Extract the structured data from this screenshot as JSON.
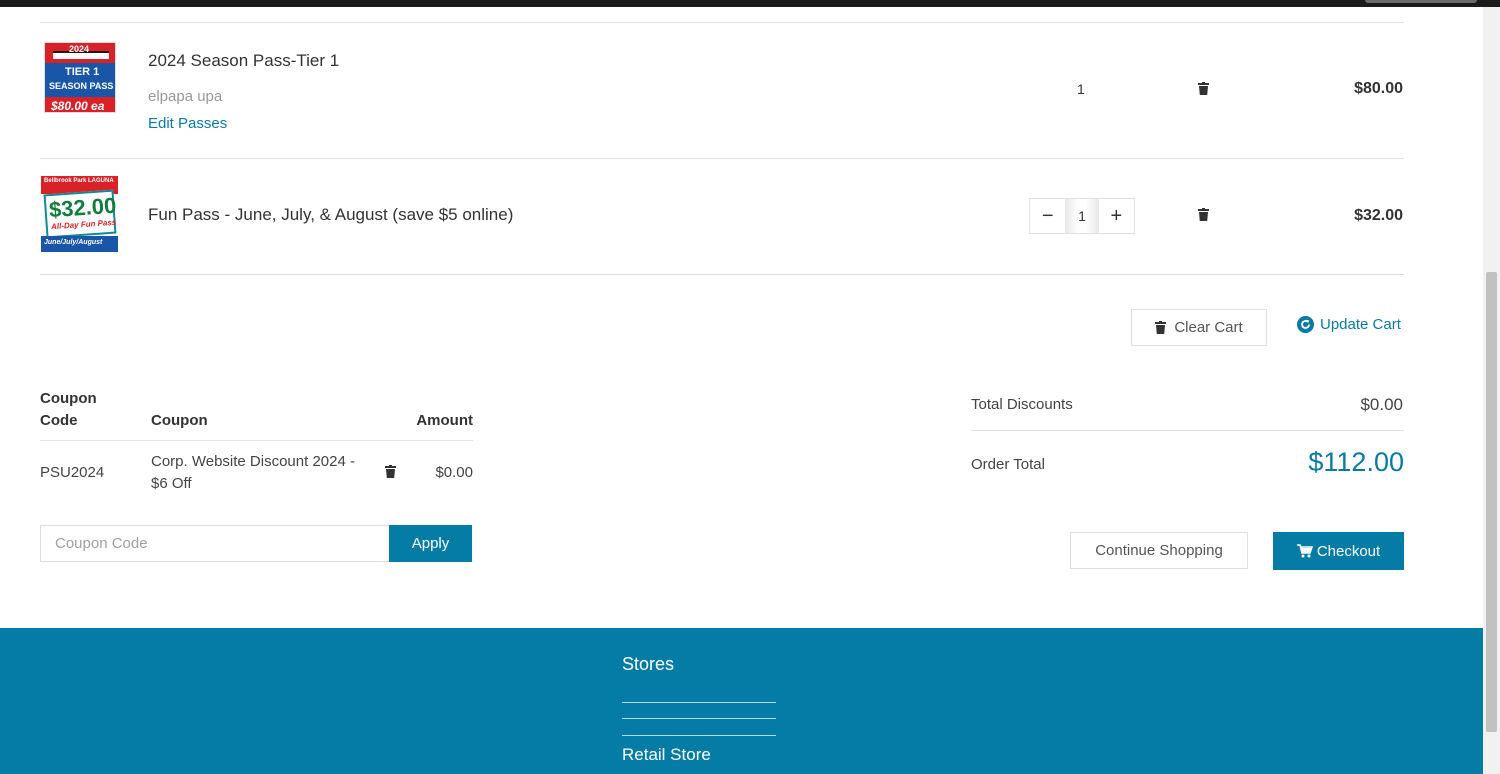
{
  "cart": {
    "items": [
      {
        "name": "2024 Season Pass-Tier 1",
        "subtitle": "elpapa upa",
        "edit_label": "Edit Passes",
        "quantity": "1",
        "price": "$80.00",
        "thumb": {
          "year": "2024",
          "tier": "TIER 1",
          "label": "SEASON PASS",
          "price": "$80.00 ea"
        }
      },
      {
        "name": "Fun Pass - June, July, & August (save $5 online)",
        "quantity": "1",
        "price": "$32.00",
        "thumb": {
          "top": "Bellbrook Park LAGUNA",
          "price": "$32.00",
          "label": "All-Day Fun Pass",
          "months": "June/July/August"
        }
      }
    ],
    "stepper": {
      "minus": "−",
      "plus": "+"
    },
    "clear_label": "Clear Cart",
    "update_label": "Update Cart"
  },
  "coupons": {
    "headers": {
      "code_line1": "Coupon",
      "code_line2": "Code",
      "coupon": "Coupon",
      "amount": "Amount"
    },
    "rows": [
      {
        "code": "PSU2024",
        "coupon_line1": "Corp. Website Discount 2024 -",
        "coupon_line2": "$6 Off",
        "amount": "$0.00"
      }
    ],
    "input_placeholder": "Coupon Code",
    "apply_label": "Apply"
  },
  "summary": {
    "discounts_label": "Total Discounts",
    "discounts_value": "$0.00",
    "total_label": "Order Total",
    "total_value": "$112.00"
  },
  "actions": {
    "continue_label": "Continue Shopping",
    "checkout_label": "Checkout"
  },
  "footer": {
    "heading": "Stores",
    "item": "Retail Store"
  },
  "colors": {
    "accent": "#057ca5",
    "link": "#0a7aa5"
  }
}
